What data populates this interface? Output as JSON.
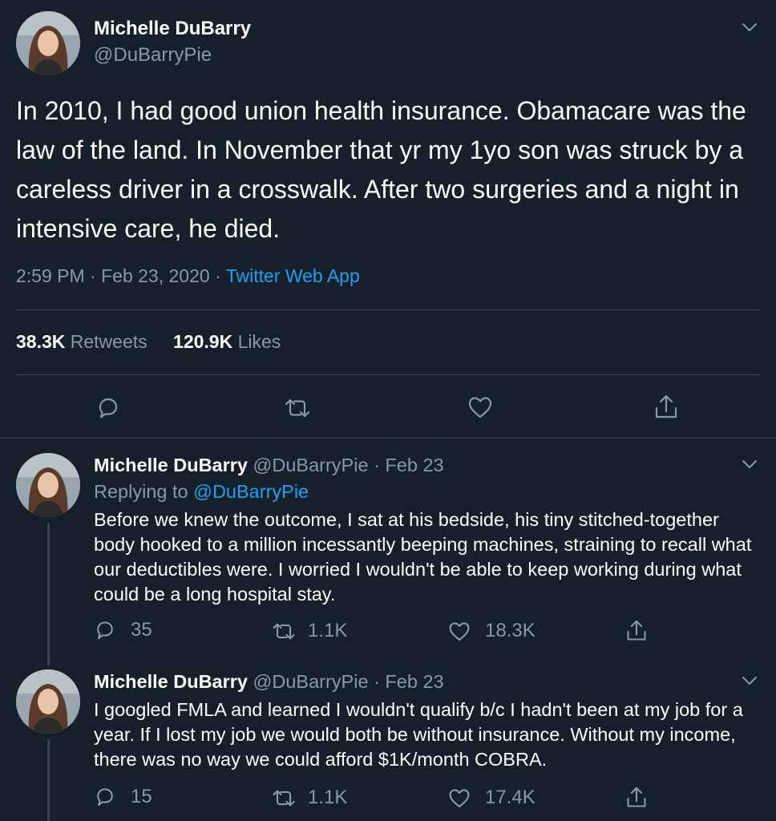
{
  "main_tweet": {
    "author_name": "Michelle DuBarry",
    "author_handle": "@DuBarryPie",
    "text": "In 2010, I had good union health insurance. Obamacare was the law of the land. In November that yr my 1yo son was struck by a careless driver in a crosswalk. After two surgeries and a night in intensive care, he died.",
    "time": "2:59 PM",
    "sep1": "·",
    "date": "Feb 23, 2020",
    "sep2": "·",
    "source": "Twitter Web App",
    "retweets_count": "38.3K",
    "retweets_label": "Retweets",
    "likes_count": "120.9K",
    "likes_label": "Likes"
  },
  "replies": [
    {
      "author_name": "Michelle DuBarry",
      "author_handle": "@DuBarryPie",
      "sep": "·",
      "date": "Feb 23",
      "replying_to_label": "Replying to",
      "replying_to_handle": "@DuBarryPie",
      "text": "Before we knew the outcome, I sat at his bedside, his tiny stitched-together body hooked to a million incessantly beeping machines, straining to recall what our deductibles were. I worried I wouldn't be able to keep working during what could be a long hospital stay.",
      "replies": "35",
      "retweets": "1.1K",
      "likes": "18.3K"
    },
    {
      "author_name": "Michelle DuBarry",
      "author_handle": "@DuBarryPie",
      "sep": "·",
      "date": "Feb 23",
      "text": "I googled FMLA and learned I wouldn't qualify b/c I hadn't been at my job for a year. If I lost my job we would both be without insurance. Without my income, there was no way we could afford $1K/month COBRA.",
      "replies": "15",
      "retweets": "1.1K",
      "likes": "17.4K"
    }
  ],
  "colors": {
    "background": "#15202b",
    "text": "#ffffff",
    "muted": "#8899a6",
    "link": "#1da1f2",
    "border": "#38444d"
  },
  "icons": [
    "chevron-down-icon",
    "reply-icon",
    "retweet-icon",
    "like-icon",
    "share-icon"
  ]
}
